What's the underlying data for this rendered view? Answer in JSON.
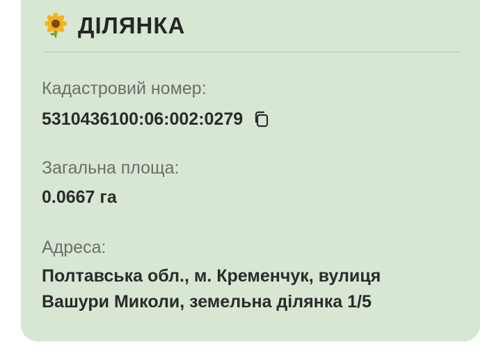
{
  "section": {
    "icon": "sunflower-icon",
    "title": "ДІЛЯНКА"
  },
  "fields": {
    "cadastral": {
      "label": "Кадастровий номер:",
      "value": "5310436100:06:002:0279",
      "copy_icon": "copy-icon"
    },
    "area": {
      "label": "Загальна площа:",
      "value": "0.0667 га"
    },
    "address": {
      "label": "Адреса:",
      "value": "Полтавська обл., м. Кременчук, вулиця Вашури Миколи, земельна ділянка 1/5"
    }
  },
  "colors": {
    "card_background": "#d7e7d3",
    "label_text": "#6b6f6b",
    "value_text": "#2b2b2b",
    "divider": "#b7c2b4"
  }
}
